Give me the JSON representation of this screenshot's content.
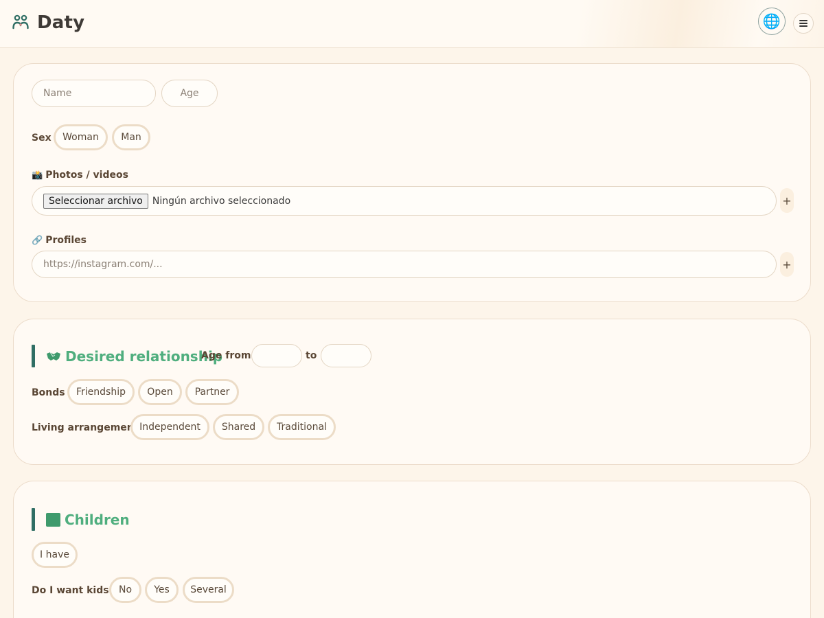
{
  "app": {
    "name": "Daty"
  },
  "header": {
    "lang_icon": "globe-icon",
    "menu_icon": "hamburger-icon"
  },
  "profile": {
    "name_placeholder": "Name",
    "age_placeholder": "Age",
    "sex_label": "Sex",
    "sex_options": [
      "Woman",
      "Man"
    ],
    "photos_icon": "📸",
    "photos_label": "Photos / videos",
    "file_button": "Seleccionar archivo",
    "file_status": "Ningún archivo seleccionado",
    "add_label": "+",
    "profiles_icon": "🔗",
    "profiles_label": "Profiles",
    "profiles_placeholder": "https://instagram.com/..."
  },
  "relationship": {
    "icon": "handshake-icon",
    "title": "Desired relationship",
    "age_from_label": "Age from",
    "age_to_label": "to",
    "bonds_label": "Bonds",
    "bonds_options": [
      "Friendship",
      "Open",
      "Partner"
    ],
    "living_label": "Living arrangement",
    "living_options": [
      "Independent",
      "Shared",
      "Traditional"
    ]
  },
  "children": {
    "icon": "baby-icon",
    "title": "Children",
    "have_chip": "I have",
    "want_label": "Do I want kids?",
    "want_options": [
      "No",
      "Yes",
      "Several"
    ]
  },
  "colors": {
    "accent": "#4fae7e",
    "accent_bar": "#2f6e64",
    "chip_border": "#ecdcc7"
  }
}
